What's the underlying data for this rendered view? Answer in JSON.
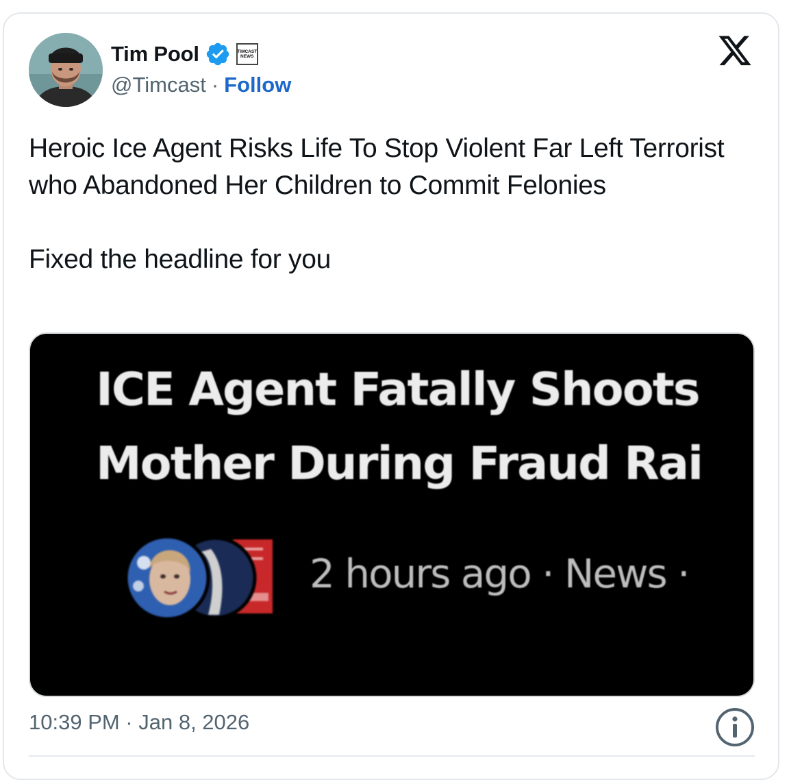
{
  "author": {
    "name": "Tim Pool",
    "handle": "@Timcast",
    "separator": "·",
    "follow_label": "Follow",
    "badge_line1": "TIMCAST",
    "badge_line2": "NEWS"
  },
  "tweet": {
    "text_line1": "Heroic Ice Agent Risks Life To Stop Violent Far Left Terrorist who Abandoned Her Children to Commit Felonies",
    "text_line2": "Fixed the headline for you"
  },
  "media": {
    "headline_line1": "ICE Agent Fatally Shoots",
    "headline_line2": "Mother During Fraud Rai",
    "meta": "2 hours ago · News ·"
  },
  "footer": {
    "timestamp": "10:39 PM · Jan 8, 2026"
  },
  "colors": {
    "accent": "#1d9bf0",
    "link": "#1d68c9",
    "text": "#0f1419",
    "muted": "#536471"
  },
  "icons": {
    "verified": "verified-badge-icon",
    "brand": "x-logo-icon",
    "info": "info-icon"
  }
}
